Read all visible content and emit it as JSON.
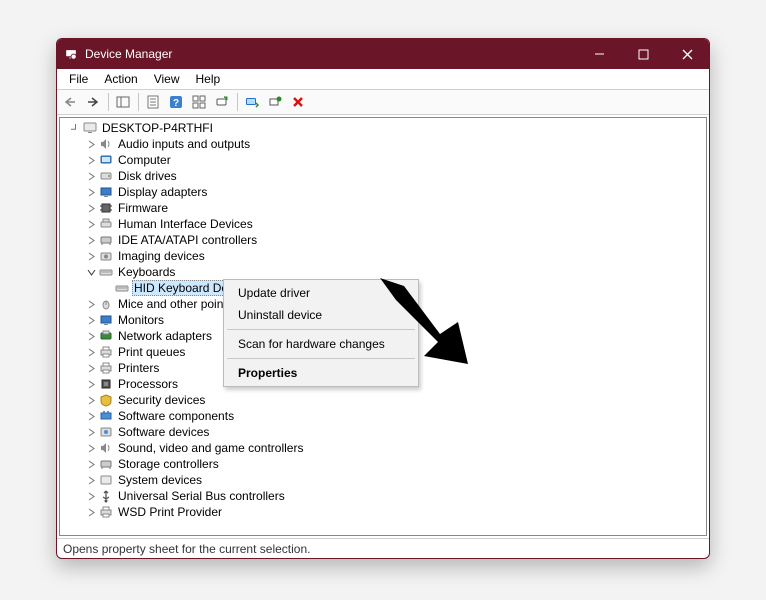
{
  "window": {
    "title": "Device Manager"
  },
  "menubar": {
    "file": "File",
    "action": "Action",
    "view": "View",
    "help": "Help"
  },
  "tree": {
    "root": "DESKTOP-P4RTHFI",
    "audio": "Audio inputs and outputs",
    "computer": "Computer",
    "disk": "Disk drives",
    "display": "Display adapters",
    "firmware": "Firmware",
    "hid": "Human Interface Devices",
    "ide": "IDE ATA/ATAPI controllers",
    "imaging": "Imaging devices",
    "keyboards": "Keyboards",
    "hid_keyboard": "HID Keyboard Device",
    "mice": "Mice and other point",
    "monitors": "Monitors",
    "network": "Network adapters",
    "printq": "Print queues",
    "printers": "Printers",
    "processors": "Processors",
    "security": "Security devices",
    "softcomp": "Software components",
    "softdev": "Software devices",
    "sound": "Sound, video and game controllers",
    "storage": "Storage controllers",
    "system": "System devices",
    "usb": "Universal Serial Bus controllers",
    "wsd": "WSD Print Provider"
  },
  "context_menu": {
    "update": "Update driver",
    "uninstall": "Uninstall device",
    "scan": "Scan for hardware changes",
    "properties": "Properties"
  },
  "statusbar": {
    "text": "Opens property sheet for the current selection."
  }
}
